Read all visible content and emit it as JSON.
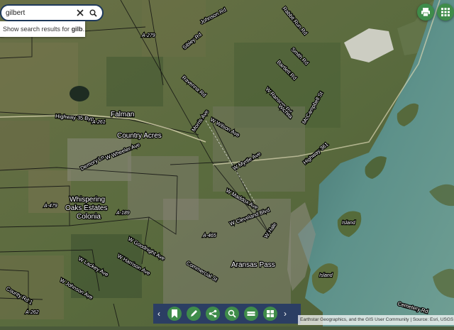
{
  "search": {
    "value": "gilbert",
    "suggestion_prefix": "Show search results for ",
    "suggestion_term": "gilb",
    "suggestion_suffix": "..."
  },
  "map": {
    "places": [
      "Falman",
      "Country Acres",
      "Whispering",
      "Oaks Estates",
      "Colonia",
      "Aransas Pass",
      "Island"
    ],
    "streets": [
      "Highway 35 Byp",
      "Morris Ave",
      "W Wheeler Ave",
      "Demory Ln",
      "W Myrtle Ave",
      "W Wilson Ave",
      "W Maddox Ave",
      "Rabbit Run Rd",
      "Johnson Rd",
      "Sibley Rd",
      "Bartlett Rd",
      "Smith Rd",
      "Wilson Rd",
      "Ravenna Rd",
      "W Ransom Rd",
      "Bayside Rd",
      "Wichita",
      "McCampbell St",
      "W Cleveland Blvd",
      "Stapp Ave",
      "Lamont St",
      "W Goodnight Ave",
      "W Harrison Ave",
      "W Lackey Ave",
      "W Lexington Ave",
      "W Johnson Ave",
      "Commercial St",
      "S Rife St",
      "Arch St",
      "W Hale",
      "S Houston St",
      "Avenue A",
      "Cemetery Rd",
      "County Rd 1",
      "Highway 361"
    ],
    "codes": [
      "A-279",
      "A-261",
      "A-479",
      "A-189",
      "A-465",
      "A-2",
      "A-262"
    ]
  },
  "toolbar": {
    "prev": "‹",
    "next": "›"
  },
  "attribution": "Earthstar Geographics, and the GIS User Community | Source: Esri, USGS",
  "icons": [
    "search-icon",
    "close-icon",
    "print-icon",
    "grid-icon",
    "bookmark-icon",
    "draw-icon",
    "share-icon",
    "zoom-search-icon",
    "basemap-icon",
    "layers-icon"
  ],
  "colors": {
    "toolbar": "#2b3e63",
    "button": "#3f8c4a",
    "search_border": "#1f3a5c"
  }
}
